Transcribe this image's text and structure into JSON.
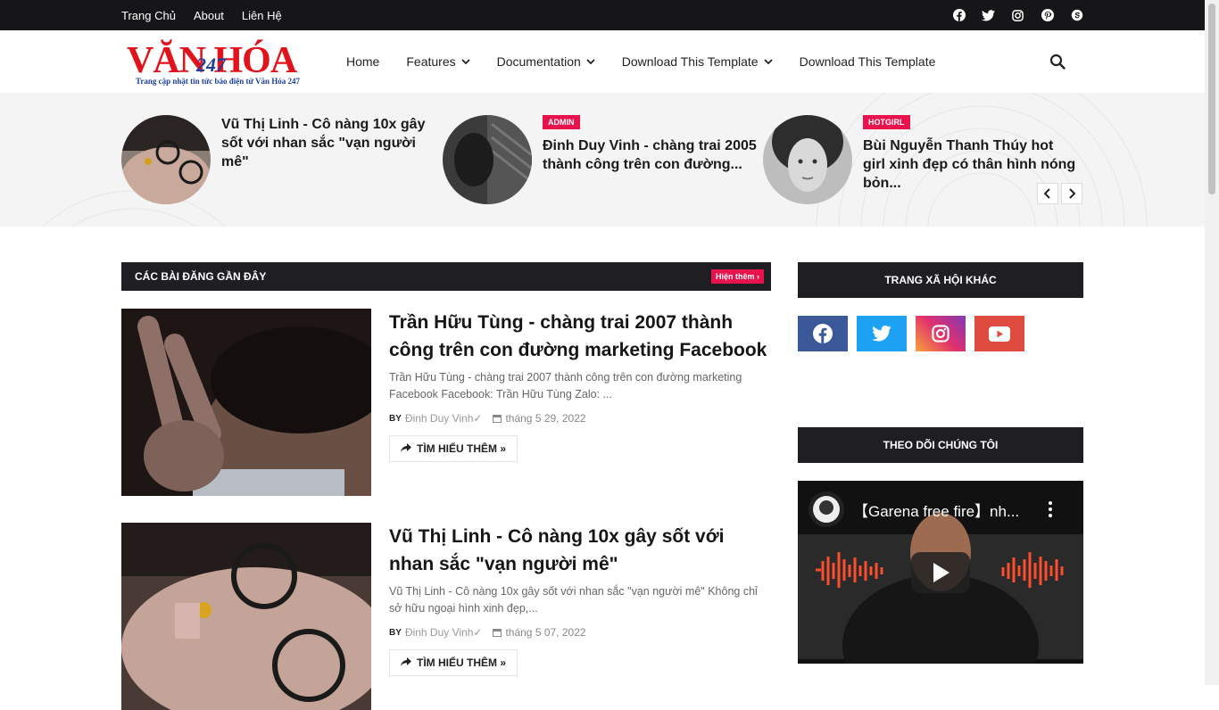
{
  "topbar": {
    "links": [
      "Trang Chủ",
      "About",
      "Liên Hệ"
    ],
    "social_icons": [
      "facebook-icon",
      "twitter-icon",
      "instagram-icon",
      "pinterest-icon",
      "skype-icon"
    ]
  },
  "logo": {
    "main_text": "VĂN HÓA",
    "number": "247",
    "tagline": "Trang cập nhật tin tức báo điện tử Văn Hóa 247"
  },
  "nav": {
    "items": [
      {
        "label": "Home",
        "has_dropdown": false
      },
      {
        "label": "Features",
        "has_dropdown": true
      },
      {
        "label": "Documentation",
        "has_dropdown": true
      },
      {
        "label": "Download This Template",
        "has_dropdown": true
      },
      {
        "label": "Download This Template",
        "has_dropdown": false
      }
    ]
  },
  "featured": [
    {
      "tag": "",
      "title": "Vũ Thị Linh - Cô nàng 10x gây sốt với nhan sắc \"vạn người mê\""
    },
    {
      "tag": "ADMIN",
      "title": "Đinh Duy Vinh - chàng trai 2005 thành công trên con đường..."
    },
    {
      "tag": "HOTGIRL",
      "title": "Bùi Nguyễn Thanh Thúy hot girl xinh đẹp có thân hình nóng bỏn..."
    }
  ],
  "recent": {
    "heading": "Các bài đăng gần đây",
    "more_label": "Hiện thêm ›",
    "posts": [
      {
        "title": "Trần Hữu Tùng - chàng trai 2007 thành công trên con đường marketing Facebook",
        "excerpt": "Trần Hữu Tùng - chàng trai 2007 thành công trên con đường marketing Facebook Facebook:   Trần Hữu Tùng Zalo: ...",
        "by": "BY",
        "author": "Đinh Duy Vinh✓",
        "date": "tháng 5 29, 2022",
        "read_more": "TÌM HIỂU THÊM »"
      },
      {
        "title": "Vũ Thị Linh - Cô nàng 10x gây sốt với nhan sắc \"vạn người mê\"",
        "excerpt": "Vũ Thị Linh - Cô nàng 10x gây sốt với nhan sắc \"vạn người mê\" Không chỉ sở hữu ngoại hình xinh đẹp,...",
        "by": "BY",
        "author": "Đinh Duy Vinh✓",
        "date": "tháng 5 07, 2022",
        "read_more": "TÌM HIỂU THÊM »"
      }
    ]
  },
  "sidebar": {
    "social_heading": "Trang xã hội khác",
    "social_buttons": [
      {
        "name": "facebook",
        "color": "#3b5998"
      },
      {
        "name": "twitter",
        "color": "#1da1f2"
      },
      {
        "name": "instagram",
        "color": "#c13584"
      },
      {
        "name": "youtube",
        "color": "#e04b3f"
      }
    ],
    "follow_heading": "Theo dõi chúng tôi",
    "video_title": "【Garena free fire】nh..."
  },
  "colors": {
    "accent": "#e8124d",
    "dark": "#1f1f23",
    "logo_red": "#e0141c",
    "logo_blue": "#1d3f9a"
  }
}
